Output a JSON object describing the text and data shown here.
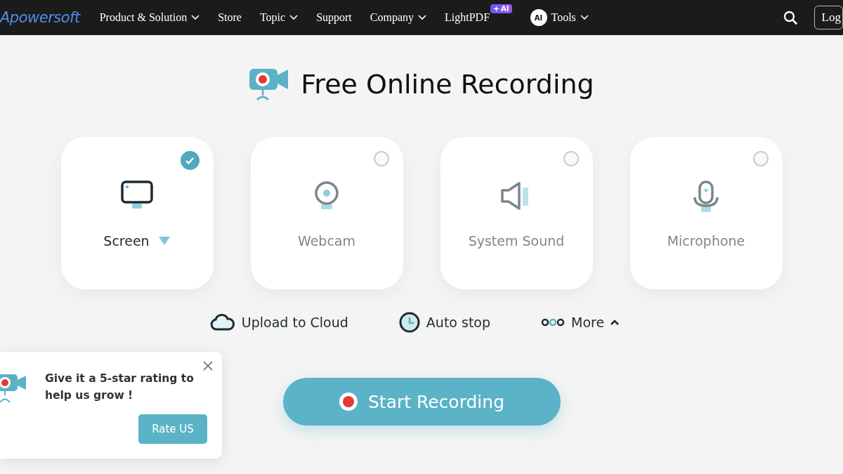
{
  "nav": {
    "logo": "Apowersoft",
    "items": [
      {
        "label": "Product & Solution",
        "dropdown": true
      },
      {
        "label": "Store",
        "dropdown": false
      },
      {
        "label": "Topic",
        "dropdown": true
      },
      {
        "label": "Support",
        "dropdown": false
      },
      {
        "label": "Company",
        "dropdown": true
      },
      {
        "label": "LightPDF",
        "dropdown": false,
        "badge": "AI"
      },
      {
        "label": "Tools",
        "dropdown": true,
        "icon_text": "AI"
      }
    ],
    "login": "Log"
  },
  "title": "Free Online Recording",
  "sources": [
    {
      "kind": "screen",
      "label": "Screen",
      "selected": true,
      "dropdown": true
    },
    {
      "kind": "webcam",
      "label": "Webcam",
      "selected": false,
      "dropdown": false
    },
    {
      "kind": "sound",
      "label": "System Sound",
      "selected": false,
      "dropdown": false
    },
    {
      "kind": "mic",
      "label": "Microphone",
      "selected": false,
      "dropdown": false
    }
  ],
  "options": [
    {
      "kind": "cloud",
      "label": "Upload to Cloud"
    },
    {
      "kind": "clock",
      "label": "Auto stop"
    },
    {
      "kind": "more",
      "label": "More",
      "expanded": true
    }
  ],
  "start_button": "Start Recording",
  "popup": {
    "message": "Give it a 5-star rating to help us grow !",
    "button": "Rate US"
  }
}
